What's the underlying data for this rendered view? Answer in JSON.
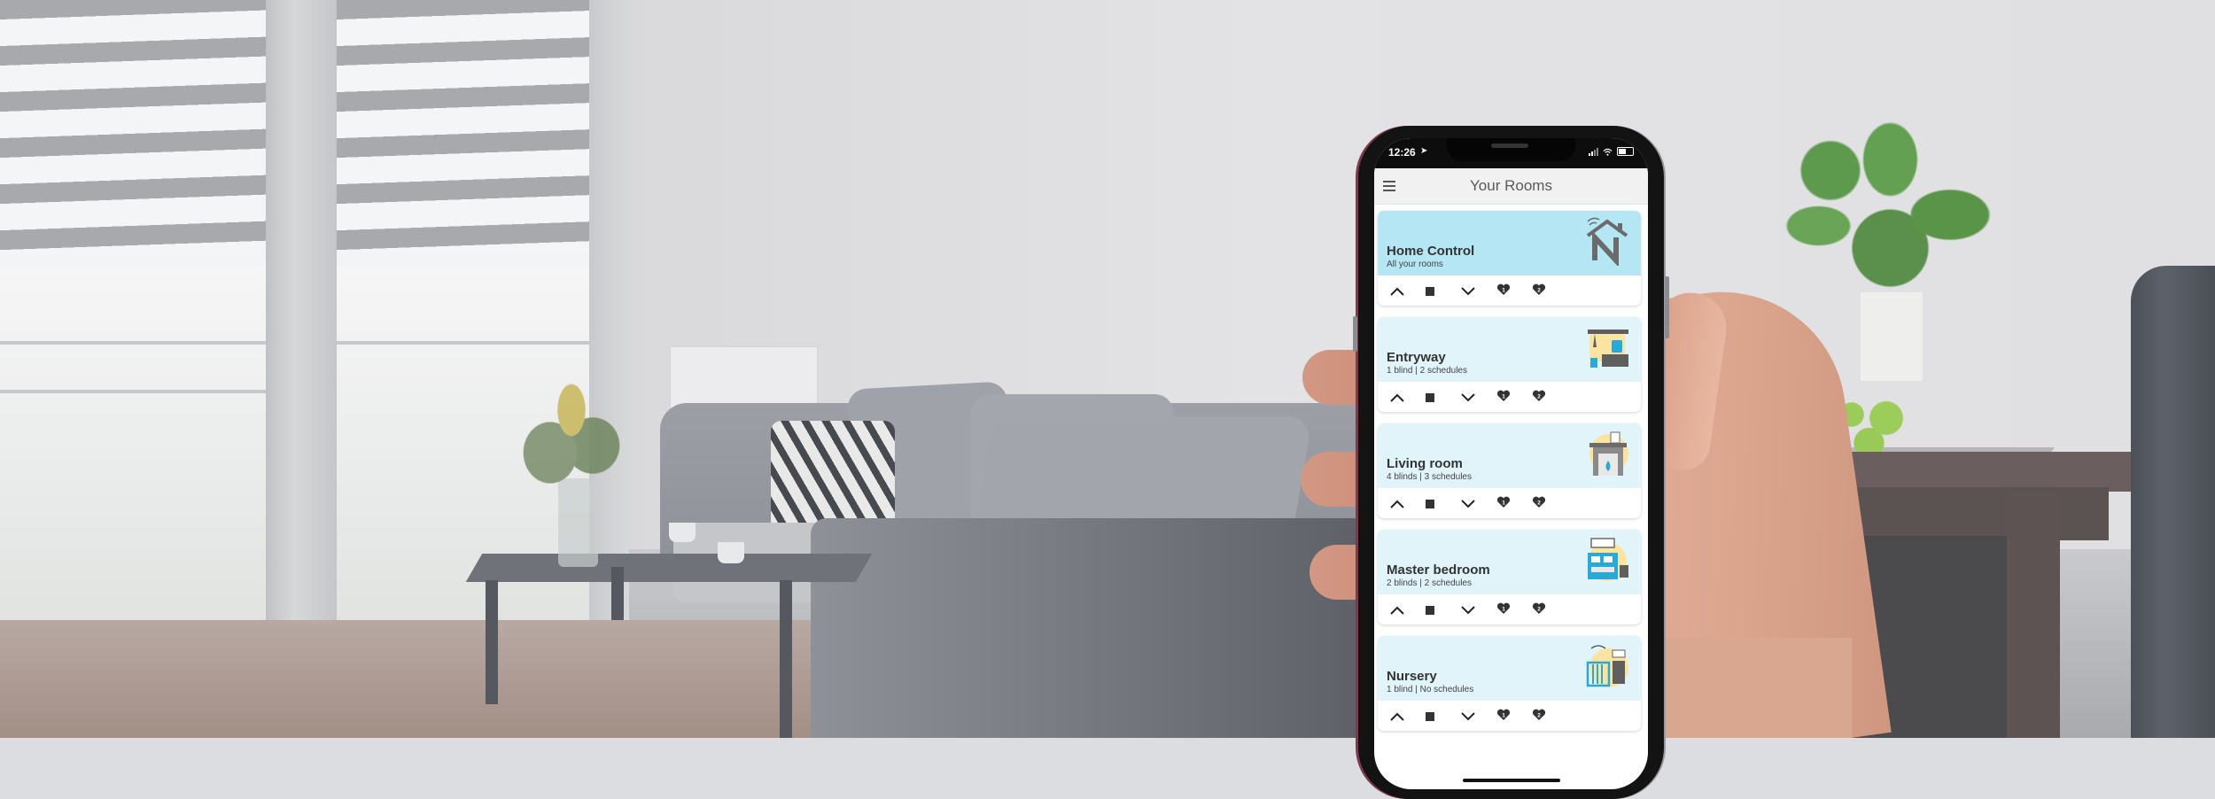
{
  "status_bar": {
    "time": "12:26",
    "location_icon": "location-arrow-icon",
    "signal_icon": "cellular-signal-icon",
    "wifi_icon": "wifi-icon",
    "battery_icon": "battery-icon"
  },
  "app_bar": {
    "menu_icon": "hamburger-menu-icon",
    "title": "Your Rooms"
  },
  "colors": {
    "card_header_primary": "#b4e7f3",
    "card_header_secondary": "#e1f4fa",
    "app_bar_bg": "#f1f1f1",
    "text_dark": "#333333",
    "icon_grey": "#6b6b6b",
    "accent_blue": "#2aa8d6",
    "accent_yellow": "#fbe3a0"
  },
  "controls": [
    {
      "name": "open-up",
      "icon": "chevron-up-icon"
    },
    {
      "name": "stop",
      "icon": "stop-square-icon"
    },
    {
      "name": "close-down",
      "icon": "chevron-down-icon"
    },
    {
      "name": "favorite-1",
      "icon": "heart-1-icon",
      "label": "1"
    },
    {
      "name": "favorite-2",
      "icon": "heart-2-icon",
      "label": "2"
    }
  ],
  "rooms": [
    {
      "name": "Home Control",
      "subtitle": "All your rooms",
      "icon": "home-n-logo-icon",
      "highlight": true
    },
    {
      "name": "Entryway",
      "subtitle": "1 blind | 2 schedules",
      "icon": "entryway-icon",
      "highlight": false
    },
    {
      "name": "Living room",
      "subtitle": "4 blinds | 3 schedules",
      "icon": "fireplace-icon",
      "highlight": false
    },
    {
      "name": "Master bedroom",
      "subtitle": "2 blinds | 2 schedules",
      "icon": "bed-icon",
      "highlight": false
    },
    {
      "name": "Nursery",
      "subtitle": "1 blind | No schedules",
      "icon": "crib-icon",
      "highlight": false
    }
  ]
}
